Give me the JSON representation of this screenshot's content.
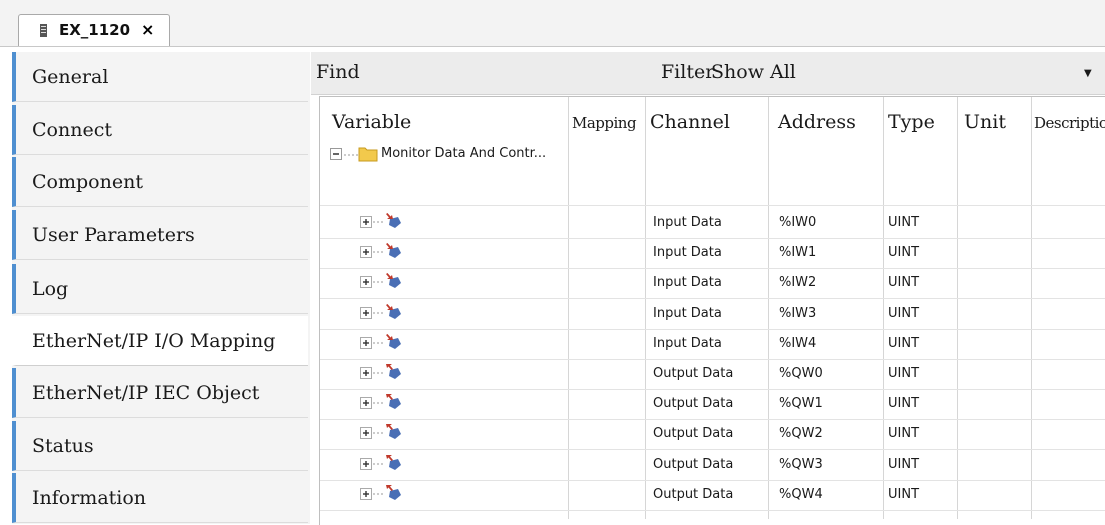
{
  "tab": {
    "title": "EX_1120",
    "close": "×"
  },
  "sidebar": {
    "items": [
      {
        "label": "General"
      },
      {
        "label": "Connect"
      },
      {
        "label": "Component"
      },
      {
        "label": "User Parameters"
      },
      {
        "label": "Log"
      },
      {
        "label": "EtherNet/IP I/O Mapping",
        "active": true
      },
      {
        "label": "EtherNet/IP IEC Object"
      },
      {
        "label": "Status"
      },
      {
        "label": "Information"
      }
    ]
  },
  "toolbar": {
    "find_label": "Find",
    "filter_label": "Filter",
    "filter_value": "Show All"
  },
  "table": {
    "headers": {
      "variable": "Variable",
      "mapping": "Mapping",
      "channel": "Channel",
      "address": "Address",
      "type": "Type",
      "unit": "Unit",
      "description": "Description"
    },
    "group": "Monitor Data And Contr...",
    "rows": [
      {
        "channel": "Input Data",
        "address": "%IW0",
        "type": "UINT",
        "dir": "input"
      },
      {
        "channel": "Input Data",
        "address": "%IW1",
        "type": "UINT",
        "dir": "input"
      },
      {
        "channel": "Input Data",
        "address": "%IW2",
        "type": "UINT",
        "dir": "input"
      },
      {
        "channel": "Input Data",
        "address": "%IW3",
        "type": "UINT",
        "dir": "input"
      },
      {
        "channel": "Input Data",
        "address": "%IW4",
        "type": "UINT",
        "dir": "input"
      },
      {
        "channel": "Output Data",
        "address": "%QW0",
        "type": "UINT",
        "dir": "output"
      },
      {
        "channel": "Output Data",
        "address": "%QW1",
        "type": "UINT",
        "dir": "output"
      },
      {
        "channel": "Output Data",
        "address": "%QW2",
        "type": "UINT",
        "dir": "output"
      },
      {
        "channel": "Output Data",
        "address": "%QW3",
        "type": "UINT",
        "dir": "output"
      },
      {
        "channel": "Output Data",
        "address": "%QW4",
        "type": "UINT",
        "dir": "output"
      }
    ]
  },
  "colors": {
    "accent": "#4f8fd0",
    "folder": "#f2c94c",
    "io_icon": "#4a6fb5",
    "io_arrow": "#c0392b"
  }
}
